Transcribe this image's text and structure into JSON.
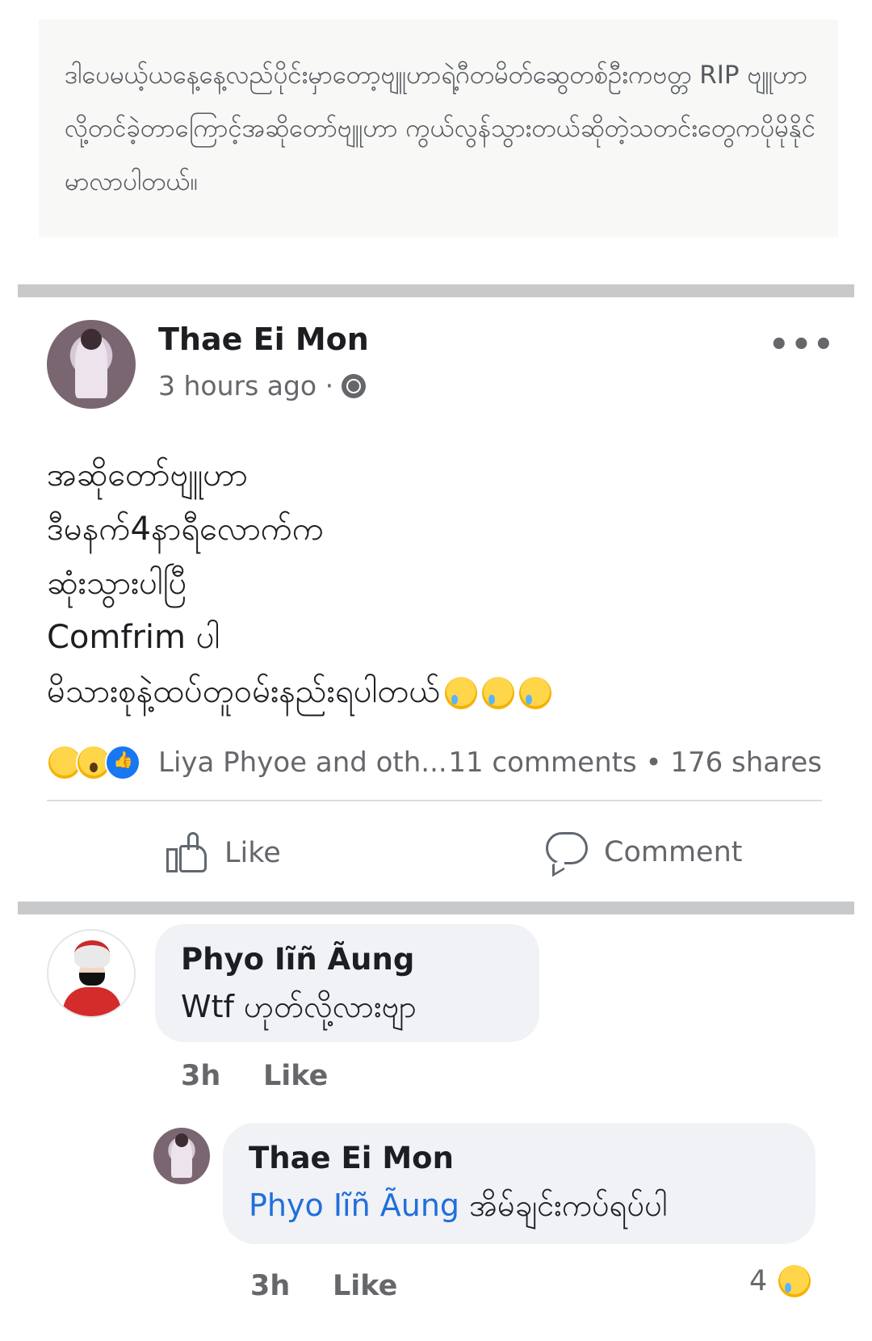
{
  "caption": {
    "text": "ဒါပေမယ့်ယနေ့နေ့လည်ပိုင်းမှာတော့ဗျူဟာရဲ့ဂီတမိတ်ဆွေတစ်ဦးကဗတ္တ RIP ဗျူဟာလို့တင်ခဲ့တာကြောင့်အဆိုတော်ဗျူဟာ ကွယ်လွန်သွားတယ်ဆိုတဲ့သတင်းတွေကပိုမိုနိုင်မာလာပါတယ်။"
  },
  "post": {
    "author": "Thae Ei Mon",
    "time": "3 hours ago ·",
    "more_label": "•••",
    "lines": [
      "အဆိုတော်ဗျူဟာ",
      "ဒီမနက်4နာရီလောက်က",
      "ဆုံးသွားပါပြီ",
      "Comfrim ပါ",
      "မိသားစုနဲ့ထပ်တူဝမ်းနည်းရပါတယ်"
    ],
    "reactions_text": "Liya Phyoe and oth...",
    "stats_text": "11 comments • 176 shares",
    "like_label": "Like",
    "comment_label": "Comment"
  },
  "comments": [
    {
      "author": "Phyo Iĩñ Ãung",
      "text": "Wtf ဟုတ်လို့လားဗျာ",
      "time": "3h",
      "like_label": "Like"
    },
    {
      "author": "Thae Ei Mon",
      "mention": "Phyo Iĩñ Ãung",
      "text": "အိမ်ချင်းကပ်ရပ်ပါ",
      "time": "3h",
      "like_label": "Like",
      "reaction_count": "4"
    }
  ],
  "icons": {
    "privacy": "globe-icon",
    "more": "more-dots-icon",
    "like": "thumbs-up-icon",
    "comment": "comment-bubble-icon",
    "reactions": [
      "sad-reaction-icon",
      "wow-reaction-icon",
      "like-reaction-icon"
    ]
  },
  "colors": {
    "link": "#216fdb",
    "like_blue": "#1877f2",
    "secondary_text": "#65676b",
    "bubble_bg": "#f0f2f5"
  }
}
